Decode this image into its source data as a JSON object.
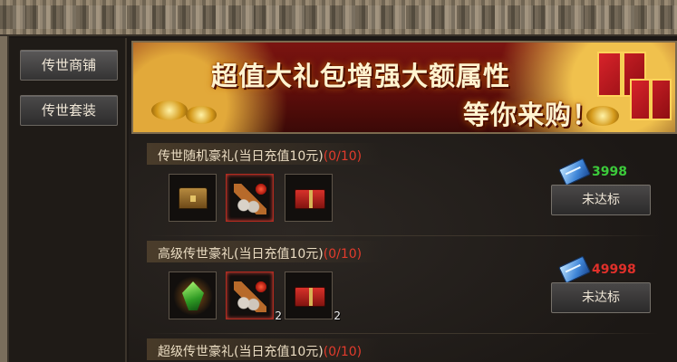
{
  "sidebar": {
    "items": [
      {
        "label": "传世商铺"
      },
      {
        "label": "传世套装"
      }
    ]
  },
  "banner": {
    "line1": "超值大礼包增强大额属性",
    "line2": "等你来购！"
  },
  "packages": [
    {
      "title": "传世随机豪礼(当日充值10元)",
      "count": "(0/10)",
      "price": "3998",
      "price_color": "#3ccb3b",
      "status": "未达标",
      "items": [
        {
          "icon": "treasure-chest-icon",
          "qty": ""
        },
        {
          "icon": "scroll-bundle-icon",
          "qty": ""
        },
        {
          "icon": "red-gift-box-icon",
          "qty": ""
        }
      ]
    },
    {
      "title": "高级传世豪礼(当日充值10元)",
      "count": "(0/10)",
      "price": "49998",
      "price_color": "#e0302a",
      "status": "未达标",
      "items": [
        {
          "icon": "green-gem-icon",
          "qty": ""
        },
        {
          "icon": "scroll-bundle-icon",
          "qty": "2"
        },
        {
          "icon": "red-gift-box-icon",
          "qty": "2"
        }
      ]
    },
    {
      "title": "超级传世豪礼(当日充值10元)",
      "count": "(0/10)"
    }
  ]
}
